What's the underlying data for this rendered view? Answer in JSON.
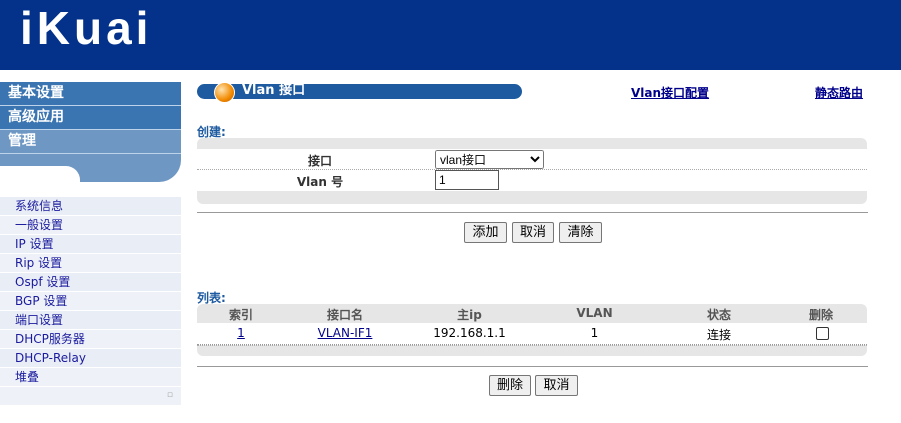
{
  "logo": "iKuai",
  "sidebar": {
    "menu": [
      "基本设置",
      "高级应用",
      "管理"
    ],
    "items": [
      "系统信息",
      "一般设置",
      "IP 设置",
      "Rip 设置",
      "Ospf 设置",
      "BGP 设置",
      "端口设置",
      "DHCP服务器",
      "DHCP-Relay",
      "堆叠"
    ]
  },
  "title": "Vlan 接口",
  "links": {
    "vlan_config": "Vlan接口配置",
    "static_route": "静态路由"
  },
  "create": {
    "label": "创建:",
    "interface_label": "接口",
    "interface_value": "vlan接口",
    "vlan_label": "Vlan 号",
    "vlan_value": "1",
    "buttons": {
      "add": "添加",
      "cancel": "取消",
      "clear": "清除"
    }
  },
  "list": {
    "label": "列表:",
    "headers": [
      "索引",
      "接口名",
      "主ip",
      "VLAN",
      "状态",
      "删除"
    ],
    "rows": [
      {
        "index": "1",
        "name": "VLAN-IF1",
        "ip": "192.168.1.1",
        "vlan": "1",
        "status": "连接",
        "checked": false
      }
    ],
    "buttons": {
      "delete": "删除",
      "cancel": "取消"
    }
  }
}
